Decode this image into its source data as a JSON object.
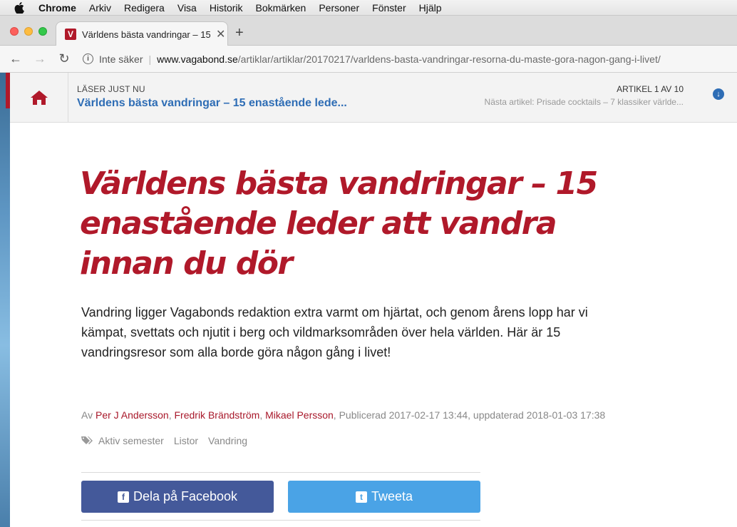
{
  "menubar": {
    "app": "Chrome",
    "items": [
      "Arkiv",
      "Redigera",
      "Visa",
      "Historik",
      "Bokmärken",
      "Personer",
      "Fönster",
      "Hjälp"
    ]
  },
  "tab": {
    "favicon_letter": "V",
    "title": "Världens bästa vandringar – 15",
    "close": "✕"
  },
  "toolbar": {
    "insecure_label": "Inte säker",
    "url_domain": "www.vagabond.se",
    "url_path": "/artiklar/artiklar/20170217/varldens-basta-vandringar-resorna-du-maste-gora-nagon-gang-i-livet/"
  },
  "reading_bar": {
    "now_label": "LÄSER JUST NU",
    "now_title": "Världens bästa vandringar – 15 enastående lede...",
    "count": "ARTIKEL 1 AV 10",
    "next": "Nästa artikel: Prisade cocktails – 7 klassiker världe..."
  },
  "article": {
    "headline": "Världens bästa vandringar – 15 enastående leder att vandra innan du dör",
    "lede": "Vandring ligger Vagabonds redaktion extra varmt om hjärtat, och genom årens lopp har vi kämpat, svettats och njutit i berg och vildmarksområden över hela världen. Här är 15 vandringsresor som alla borde göra någon gång i livet!",
    "byline_prefix": "Av ",
    "authors": [
      "Per J Andersson",
      "Fredrik Brändström",
      "Mikael Persson"
    ],
    "published": "Publicerad 2017-02-17 13:44, uppdaterad 2018-01-03 17:38",
    "tags": [
      "Aktiv semester",
      "Listor",
      "Vandring"
    ]
  },
  "share": {
    "facebook_label": "Dela på Facebook",
    "twitter_label": "Tweeta"
  },
  "colors": {
    "brand_red": "#b0192a",
    "link_blue": "#2e6db5",
    "facebook": "#44599a",
    "twitter": "#4aa3e6"
  }
}
